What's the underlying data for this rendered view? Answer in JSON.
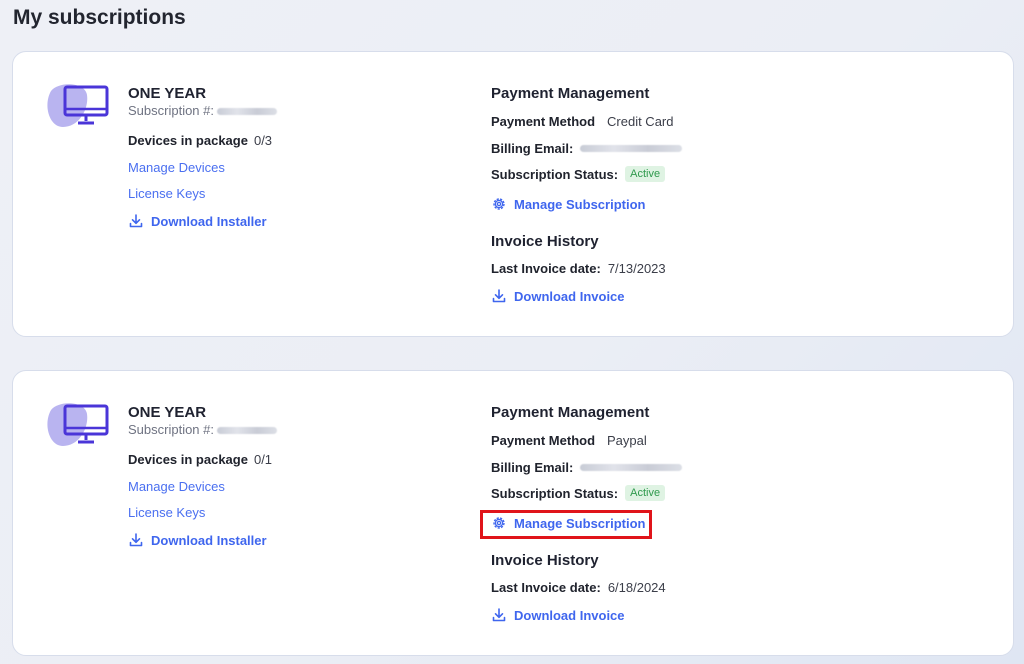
{
  "page": {
    "title": "My subscriptions"
  },
  "colors": {
    "accent": "#4a6ff0",
    "active_badge_bg": "#dff3e3",
    "active_badge_text": "#2f9a4d",
    "highlight": "#e0141a"
  },
  "subscriptions": [
    {
      "plan": "ONE YEAR",
      "subscription_label": "Subscription #:",
      "devices_label": "Devices in package",
      "devices_value": "0/3",
      "manage_devices": "Manage Devices",
      "license_keys": "License Keys",
      "download_installer": "Download Installer",
      "payment_title": "Payment Management",
      "payment_method_label": "Payment Method",
      "payment_method_value": "Credit Card",
      "billing_email_label": "Billing Email:",
      "status_label": "Subscription Status:",
      "status_value": "Active",
      "manage_subscription": "Manage Subscription",
      "invoice_title": "Invoice History",
      "last_invoice_label": "Last Invoice date:",
      "last_invoice_value": "7/13/2023",
      "download_invoice": "Download Invoice"
    },
    {
      "plan": "ONE YEAR",
      "subscription_label": "Subscription #:",
      "devices_label": "Devices in package",
      "devices_value": "0/1",
      "manage_devices": "Manage Devices",
      "license_keys": "License Keys",
      "download_installer": "Download Installer",
      "payment_title": "Payment Management",
      "payment_method_label": "Payment Method",
      "payment_method_value": "Paypal",
      "billing_email_label": "Billing Email:",
      "status_label": "Subscription Status:",
      "status_value": "Active",
      "manage_subscription": "Manage Subscription",
      "invoice_title": "Invoice History",
      "last_invoice_label": "Last Invoice date:",
      "last_invoice_value": "6/18/2024",
      "download_invoice": "Download Invoice"
    }
  ],
  "icons": {
    "device": "monitor-icon",
    "download": "download-icon",
    "settings": "gear-icon"
  }
}
